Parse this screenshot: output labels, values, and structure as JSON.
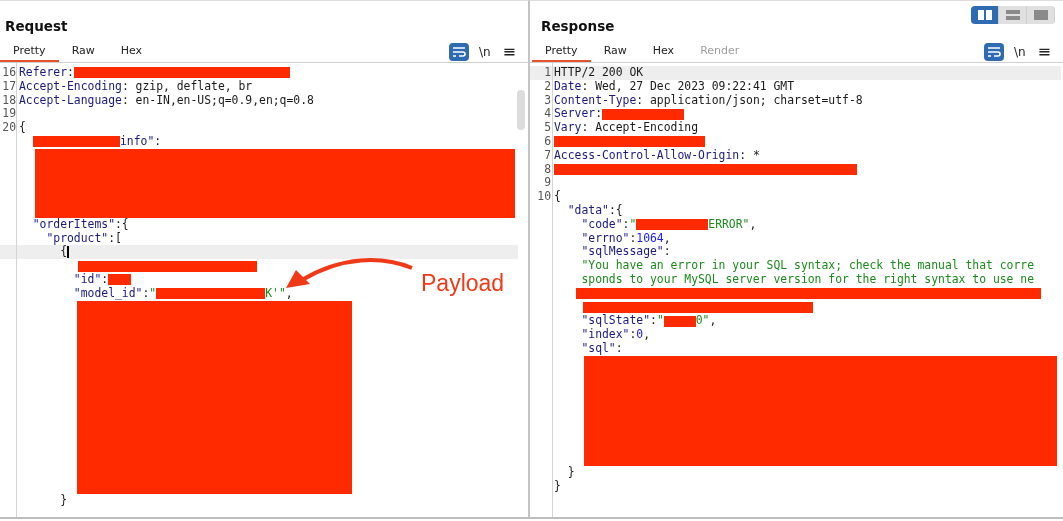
{
  "layout_toggle": [
    {
      "selected": true
    },
    {
      "selected": false
    },
    {
      "selected": false
    }
  ],
  "panels": [
    {
      "title": "Request",
      "tabs": [
        {
          "label": "Pretty",
          "selected": true,
          "disabled": false
        },
        {
          "label": "Raw",
          "selected": false,
          "disabled": false
        },
        {
          "label": "Hex",
          "selected": false,
          "disabled": false
        }
      ],
      "toolbar": {
        "newline_label": "\\n",
        "menu_label": "≡"
      },
      "annotation": {
        "label": "Payload"
      },
      "lines": [
        {
          "kind": "code",
          "number": "16",
          "tokens": [
            {
              "kind": "key",
              "text": "Referer"
            },
            {
              "kind": "punct",
              "text": ":"
            },
            {
              "kind": "redacted"
            }
          ]
        },
        {
          "kind": "code",
          "number": "17",
          "tokens": [
            {
              "kind": "key",
              "text": "Accept-Encoding"
            },
            {
              "kind": "plain",
              "text": ": gzip, deflate, br"
            }
          ]
        },
        {
          "kind": "code",
          "number": "18",
          "tokens": [
            {
              "kind": "key",
              "text": "Accept-Language"
            },
            {
              "kind": "plain",
              "text": ": en-IN,en-US;q=0.9,en;q=0.8"
            }
          ]
        },
        {
          "kind": "code",
          "number": "19"
        },
        {
          "kind": "code",
          "number": "20",
          "tokens": [
            {
              "kind": "punct",
              "text": "{"
            }
          ]
        },
        {
          "kind": "code",
          "tokens": [
            {
              "kind": "redacted"
            },
            {
              "kind": "key",
              "text": "info\""
            },
            {
              "kind": "punct",
              "text": ":"
            }
          ]
        },
        {
          "kind": "redacted-block"
        },
        {
          "kind": "code",
          "tokens": [
            {
              "kind": "key",
              "text": "  \"orderItems\""
            },
            {
              "kind": "punct",
              "text": ":{"
            }
          ]
        },
        {
          "kind": "code",
          "tokens": [
            {
              "kind": "key",
              "text": "    \"product\""
            },
            {
              "kind": "punct",
              "text": ":["
            }
          ]
        },
        {
          "kind": "code",
          "highlighted": true,
          "tokens": [
            {
              "kind": "punct",
              "text": "      {"
            },
            {
              "kind": "cursor"
            }
          ]
        },
        {
          "kind": "code",
          "tokens": [
            {
              "kind": "redacted"
            }
          ]
        },
        {
          "kind": "code",
          "tokens": [
            {
              "kind": "key",
              "text": "        \"id\""
            },
            {
              "kind": "punct",
              "text": ":"
            },
            {
              "kind": "redacted"
            }
          ]
        },
        {
          "kind": "code",
          "tokens": [
            {
              "kind": "key",
              "text": "        \"model_id\""
            },
            {
              "kind": "punct",
              "text": ":"
            },
            {
              "kind": "string",
              "text": "\""
            },
            {
              "kind": "redacted"
            },
            {
              "kind": "string",
              "text": "K'\""
            },
            {
              "kind": "punct",
              "text": ","
            }
          ]
        },
        {
          "kind": "redacted-block"
        },
        {
          "kind": "code",
          "tokens": [
            {
              "kind": "punct",
              "text": "      }"
            }
          ]
        }
      ]
    },
    {
      "title": "Response",
      "tabs": [
        {
          "label": "Pretty",
          "selected": true,
          "disabled": false
        },
        {
          "label": "Raw",
          "selected": false,
          "disabled": false
        },
        {
          "label": "Hex",
          "selected": false,
          "disabled": false
        },
        {
          "label": "Render",
          "selected": false,
          "disabled": true
        }
      ],
      "toolbar": {
        "newline_label": "\\n",
        "menu_label": "≡"
      },
      "lines": [
        {
          "kind": "code",
          "number": "1",
          "highlighted": true,
          "tokens": [
            {
              "kind": "plain",
              "text": "HTTP/2 200 OK"
            }
          ]
        },
        {
          "kind": "code",
          "number": "2",
          "tokens": [
            {
              "kind": "key",
              "text": "Date"
            },
            {
              "kind": "plain",
              "text": ": Wed, 27 Dec 2023 09:22:41 GMT"
            }
          ]
        },
        {
          "kind": "code",
          "number": "3",
          "tokens": [
            {
              "kind": "key",
              "text": "Content-Type"
            },
            {
              "kind": "plain",
              "text": ": application/json; charset=utf-8"
            }
          ]
        },
        {
          "kind": "code",
          "number": "4",
          "tokens": [
            {
              "kind": "key",
              "text": "Server"
            },
            {
              "kind": "punct",
              "text": ":"
            },
            {
              "kind": "redacted"
            }
          ]
        },
        {
          "kind": "code",
          "number": "5",
          "tokens": [
            {
              "kind": "key",
              "text": "Vary"
            },
            {
              "kind": "plain",
              "text": ": Accept-Encoding"
            }
          ]
        },
        {
          "kind": "code",
          "number": "6",
          "tokens": [
            {
              "kind": "redacted"
            }
          ]
        },
        {
          "kind": "code",
          "number": "7",
          "tokens": [
            {
              "kind": "key",
              "text": "Access-Control-Allow-Origin"
            },
            {
              "kind": "plain",
              "text": ": *"
            }
          ]
        },
        {
          "kind": "code",
          "number": "8",
          "tokens": [
            {
              "kind": "redacted"
            }
          ]
        },
        {
          "kind": "code",
          "number": "9"
        },
        {
          "kind": "code",
          "number": "10",
          "tokens": [
            {
              "kind": "punct",
              "text": "{"
            }
          ]
        },
        {
          "kind": "code",
          "tokens": [
            {
              "kind": "key",
              "text": "  \"data\""
            },
            {
              "kind": "punct",
              "text": ":{"
            }
          ]
        },
        {
          "kind": "code",
          "tokens": [
            {
              "kind": "key",
              "text": "    \"code\""
            },
            {
              "kind": "punct",
              "text": ":"
            },
            {
              "kind": "string",
              "text": "\""
            },
            {
              "kind": "redacted"
            },
            {
              "kind": "string",
              "text": "ERROR\""
            },
            {
              "kind": "punct",
              "text": ","
            }
          ]
        },
        {
          "kind": "code",
          "tokens": [
            {
              "kind": "key",
              "text": "    \"errno\""
            },
            {
              "kind": "punct",
              "text": ":"
            },
            {
              "kind": "number",
              "text": "1064"
            },
            {
              "kind": "punct",
              "text": ","
            }
          ]
        },
        {
          "kind": "code",
          "tokens": [
            {
              "kind": "key",
              "text": "    \"sqlMessage\""
            },
            {
              "kind": "punct",
              "text": ":"
            }
          ]
        },
        {
          "kind": "code",
          "tokens": [
            {
              "kind": "string",
              "text": "    \"You have an error in your SQL syntax; check the manual that corre"
            }
          ]
        },
        {
          "kind": "code",
          "tokens": [
            {
              "kind": "string",
              "text": "    sponds to your MySQL server version for the right syntax to use ne"
            }
          ]
        },
        {
          "kind": "code",
          "tokens": [
            {
              "kind": "redacted"
            }
          ]
        },
        {
          "kind": "code",
          "tokens": [
            {
              "kind": "redacted"
            }
          ]
        },
        {
          "kind": "code",
          "tokens": [
            {
              "kind": "key",
              "text": "    \"sqlState\""
            },
            {
              "kind": "punct",
              "text": ":"
            },
            {
              "kind": "string",
              "text": "\""
            },
            {
              "kind": "redacted"
            },
            {
              "kind": "string",
              "text": "0\""
            },
            {
              "kind": "punct",
              "text": ","
            }
          ]
        },
        {
          "kind": "code",
          "tokens": [
            {
              "kind": "key",
              "text": "    \"index\""
            },
            {
              "kind": "punct",
              "text": ":"
            },
            {
              "kind": "number",
              "text": "0"
            },
            {
              "kind": "punct",
              "text": ","
            }
          ]
        },
        {
          "kind": "code",
          "tokens": [
            {
              "kind": "key",
              "text": "    \"sql\""
            },
            {
              "kind": "punct",
              "text": ":"
            }
          ]
        },
        {
          "kind": "redacted-block"
        },
        {
          "kind": "code",
          "tokens": [
            {
              "kind": "punct",
              "text": "  }"
            }
          ]
        },
        {
          "kind": "code",
          "tokens": [
            {
              "kind": "punct",
              "text": "}"
            }
          ]
        }
      ]
    }
  ]
}
